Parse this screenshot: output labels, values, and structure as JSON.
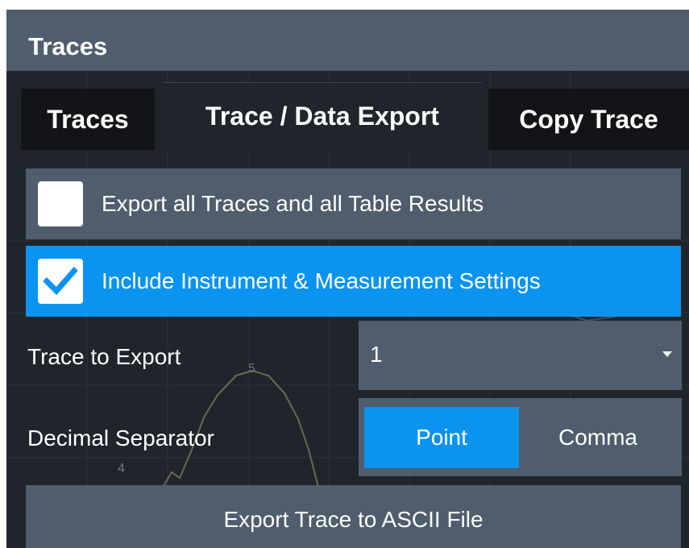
{
  "window": {
    "title": "Traces"
  },
  "tabs": [
    {
      "label": "Traces"
    },
    {
      "label": "Trace / Data Export"
    },
    {
      "label": "Copy Trace"
    }
  ],
  "active_tab": "Trace / Data Export",
  "options": {
    "export_all": {
      "label": "Export all Traces and all Table Results",
      "checked": false
    },
    "include_settings": {
      "label": "Include Instrument & Measurement Settings",
      "checked": true
    }
  },
  "trace_to_export": {
    "label": "Trace to Export",
    "value": "1"
  },
  "decimal_separator": {
    "label": "Decimal Separator",
    "options": [
      "Point",
      "Comma"
    ],
    "selected": "Point"
  },
  "export_button": {
    "label": "Export Trace to ASCII File"
  },
  "background_trace": {
    "marker_labels": [
      "5",
      "4"
    ]
  },
  "colors": {
    "title_bar": "#4f5d6d",
    "accent": "#0b93f0",
    "content_bg": "#20252c",
    "tab_inactive": "#121417"
  }
}
